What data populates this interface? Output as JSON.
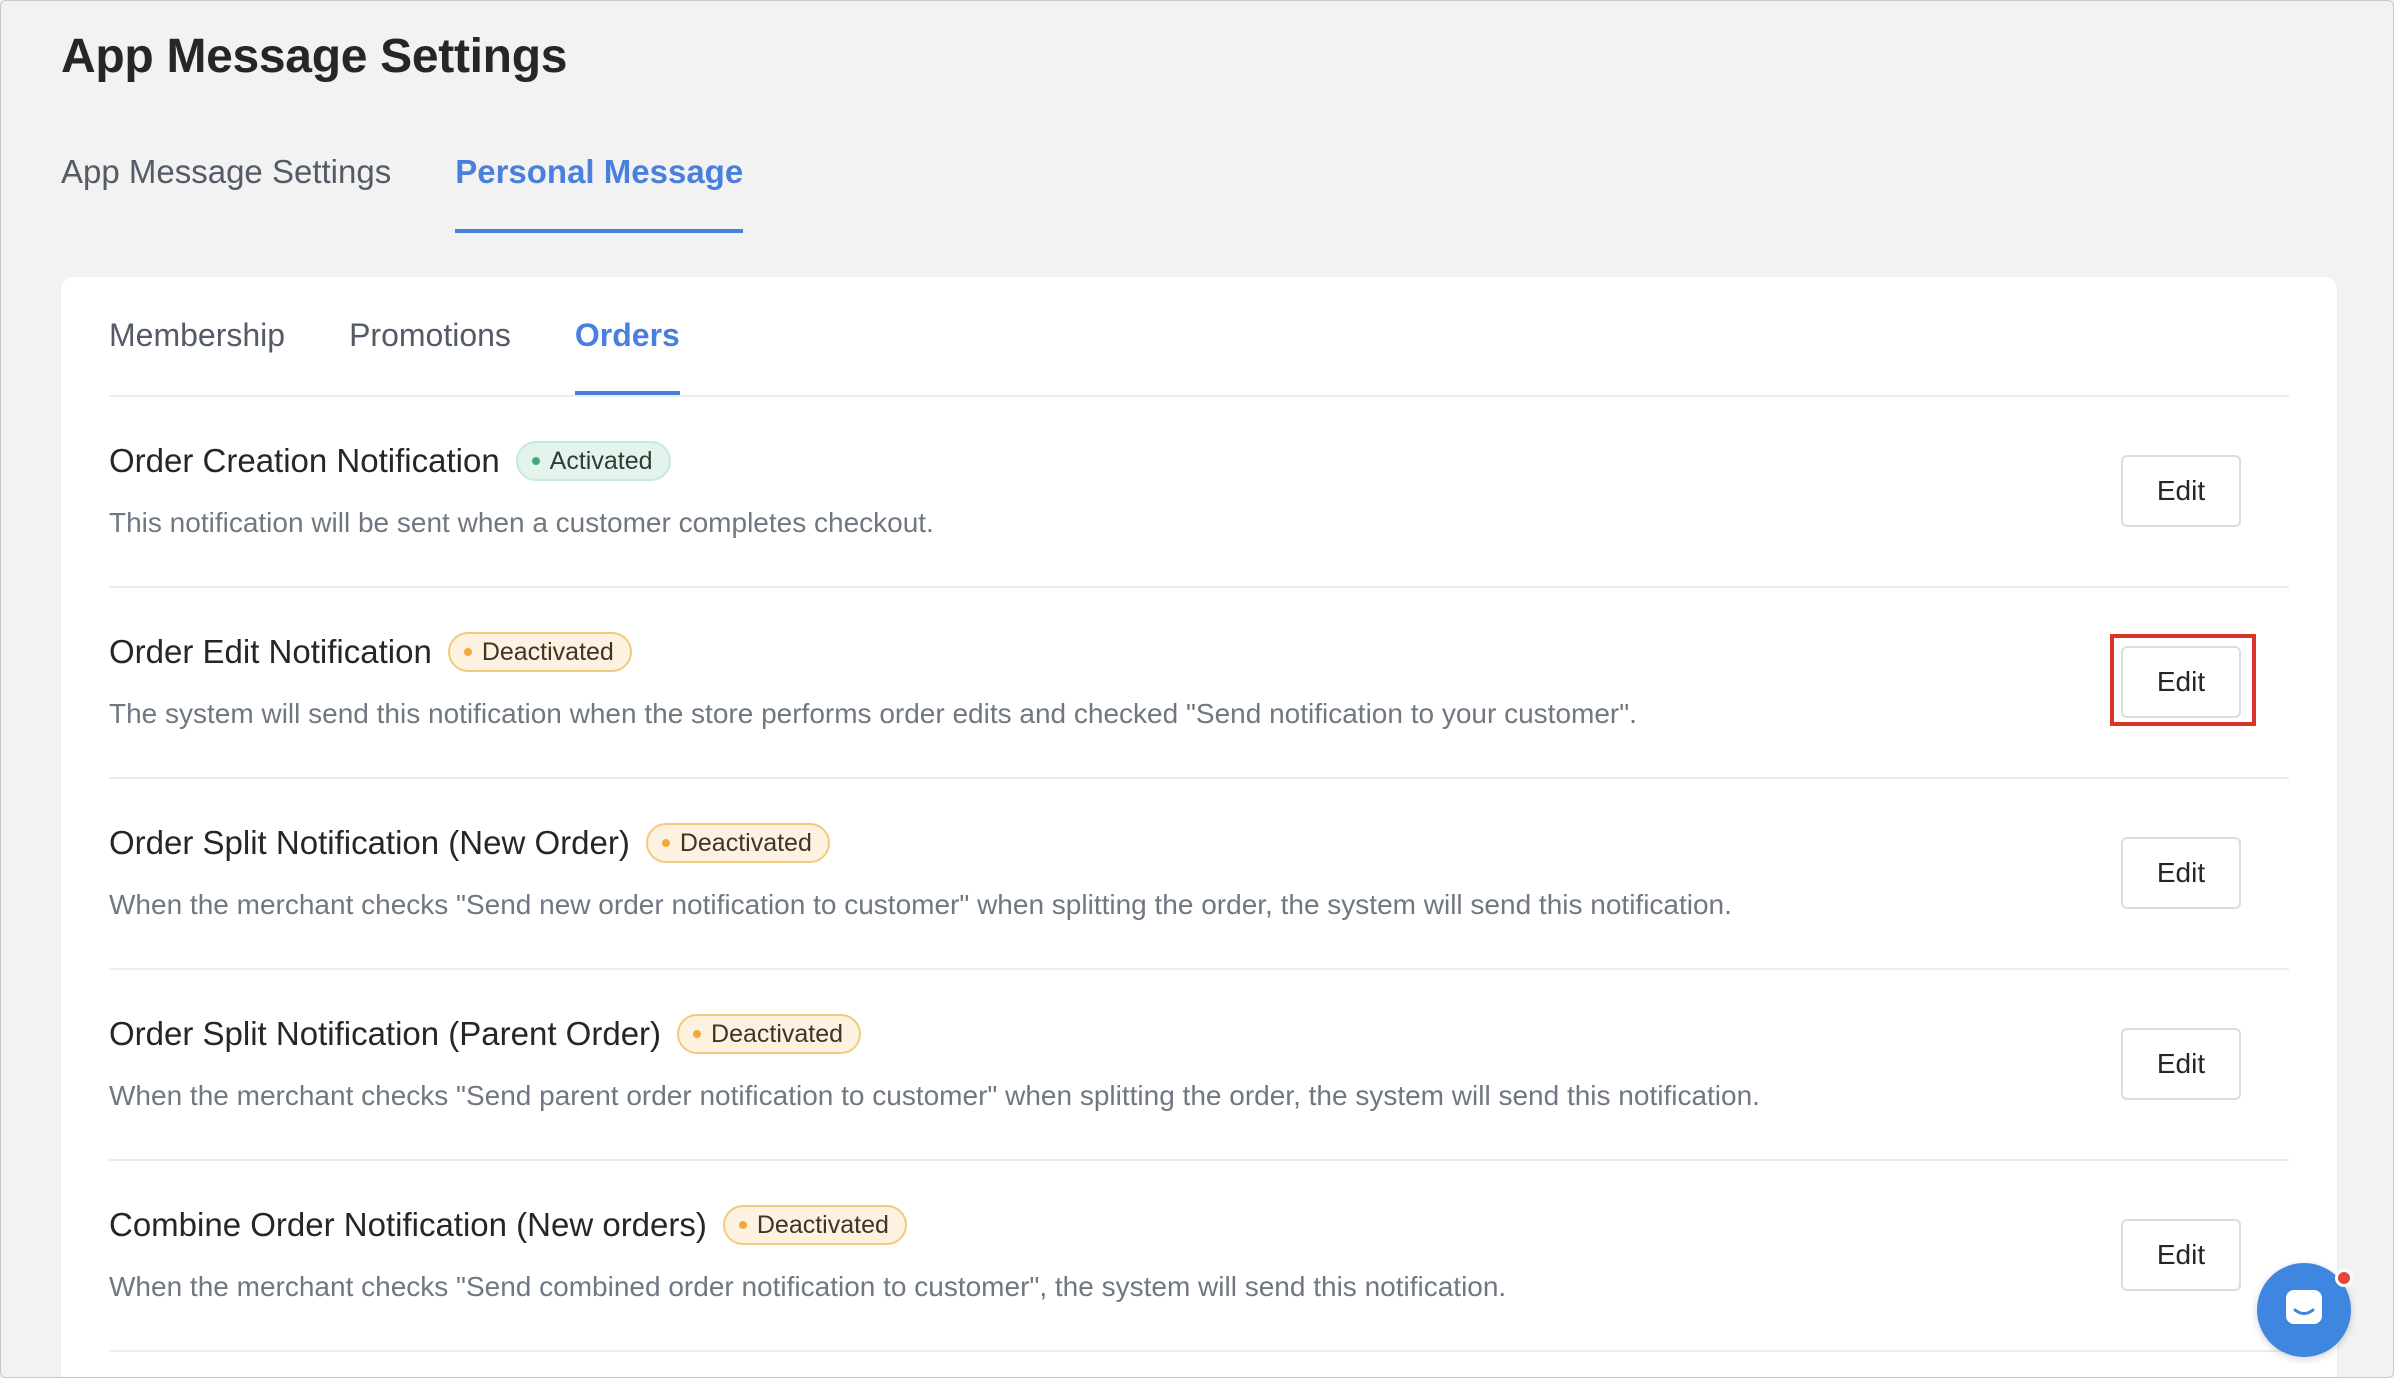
{
  "page": {
    "title": "App Message Settings"
  },
  "top_tabs": [
    {
      "label": "App Message Settings",
      "active": false
    },
    {
      "label": "Personal Message",
      "active": true
    }
  ],
  "sub_tabs": [
    {
      "label": "Membership",
      "active": false
    },
    {
      "label": "Promotions",
      "active": false
    },
    {
      "label": "Orders",
      "active": true
    }
  ],
  "notifications": [
    {
      "title": "Order Creation Notification",
      "status": "Activated",
      "description": "This notification will be sent when a customer completes checkout.",
      "action": "Edit"
    },
    {
      "title": "Order Edit Notification",
      "status": "Deactivated",
      "description": "The system will send this notification when the store performs order edits and checked \"Send notification to your customer\".",
      "action": "Edit"
    },
    {
      "title": "Order Split Notification (New Order)",
      "status": "Deactivated",
      "description": "When the merchant checks \"Send new order notification to customer\" when splitting the order, the system will send this notification.",
      "action": "Edit"
    },
    {
      "title": "Order Split Notification (Parent Order)",
      "status": "Deactivated",
      "description": "When the merchant checks \"Send parent order notification to customer\" when splitting the order, the system will send this notification.",
      "action": "Edit"
    },
    {
      "title": "Combine Order Notification (New orders)",
      "status": "Deactivated",
      "description": "When the merchant checks \"Send combined order notification to customer\", the system will send this notification.",
      "action": "Edit"
    }
  ],
  "colors": {
    "accent": "#4a80db",
    "activated": "#3fae7a",
    "deactivated": "#f0a93a",
    "highlight": "#d9362b",
    "chat": "#3f86e0"
  },
  "icons": {
    "chat_widget": "chat-bubble-icon"
  }
}
